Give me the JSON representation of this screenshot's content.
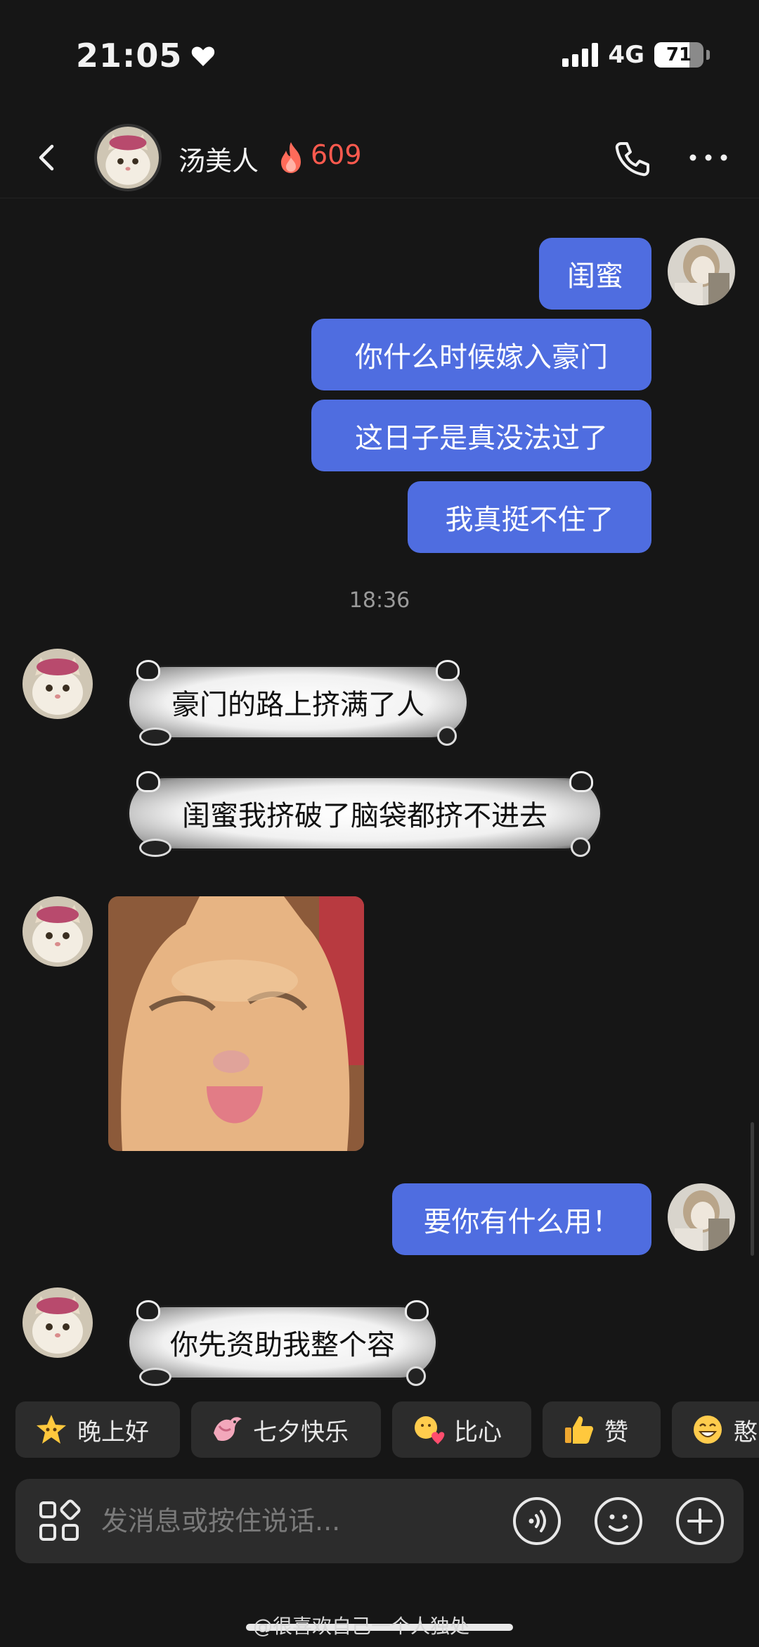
{
  "status_bar": {
    "time": "21:05",
    "network": "4G",
    "battery": "71",
    "battery_level": 0.71
  },
  "header": {
    "name": "汤美人",
    "streak": "609"
  },
  "messages": {
    "out1": "闺蜜",
    "out2": "你什么时候嫁入豪门",
    "out3": "这日子是真没法过了",
    "out4": "我真挺不住了",
    "timestamp": "18:36",
    "in1": "豪门的路上挤满了人",
    "in2": "闺蜜我挤破了脑袋都挤不进去",
    "out5": "要你有什么用！",
    "in3": "你先资助我整个容"
  },
  "quick_replies": [
    {
      "label": "晚上好",
      "icon": "star-emoji-icon"
    },
    {
      "label": "七夕快乐",
      "icon": "magpie-emoji-icon"
    },
    {
      "label": "比心",
      "icon": "heart-hands-emoji-icon"
    },
    {
      "label": "赞",
      "icon": "thumbs-up-emoji-icon"
    },
    {
      "label": "憨",
      "icon": "grin-emoji-icon"
    }
  ],
  "input": {
    "placeholder": "发消息或按住说话..."
  },
  "watermark": "@很喜欢自己一个人独处",
  "colors": {
    "background": "#161616",
    "outgoing_bubble": "#4f6de0",
    "streak": "#ff5a4e",
    "chip": "#2c2c2c"
  }
}
